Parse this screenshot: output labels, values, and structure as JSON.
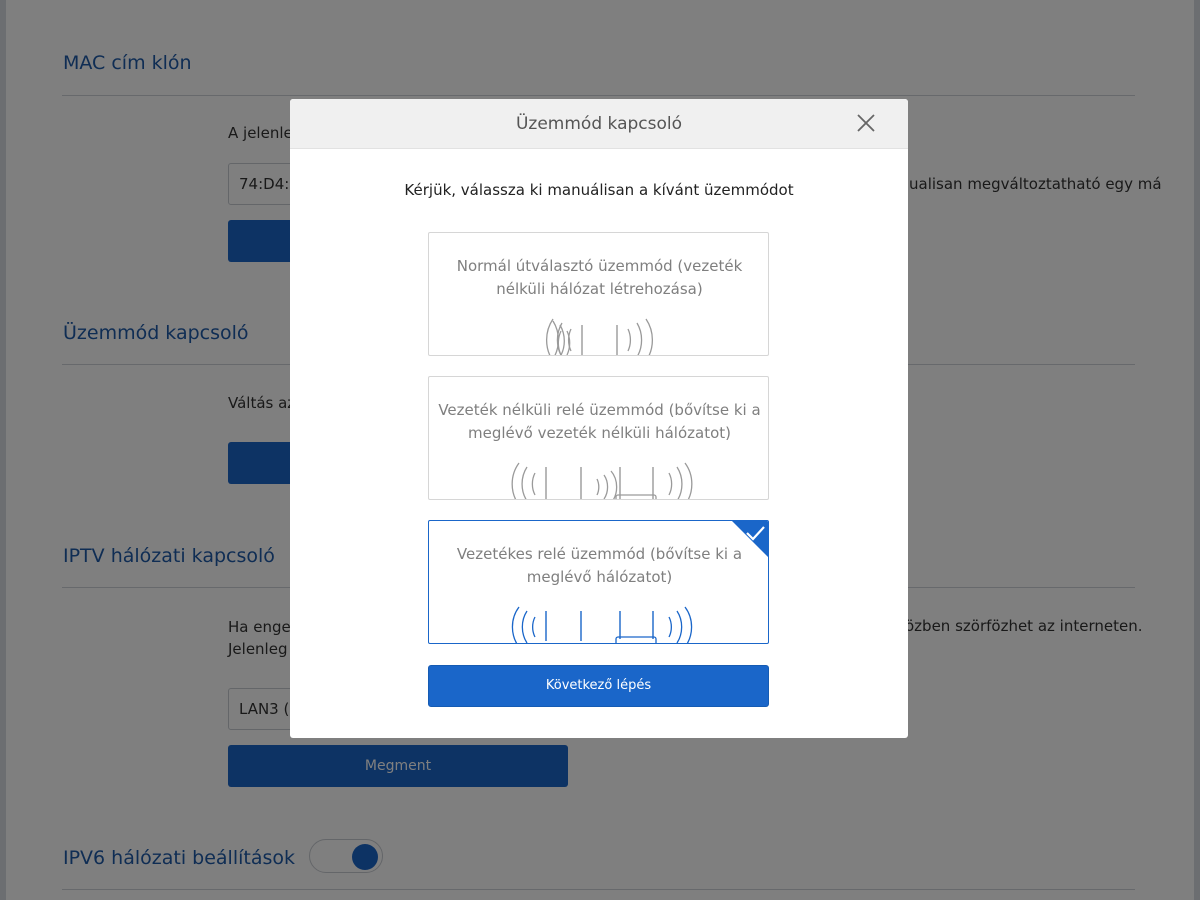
{
  "background": {
    "sections": [
      {
        "title": "MAC cím klón"
      },
      {
        "title": "Üzemmód kapcsoló"
      },
      {
        "title": "IPTV hálózati kapcsoló"
      },
      {
        "title": "IPV6 hálózati beállítások"
      }
    ],
    "mac": {
      "desc_start": "A jelenleg",
      "desc_end": "ualisan megváltoztatható egy má",
      "value": "74:D4:3"
    },
    "mode": {
      "desc_start": "Váltás az"
    },
    "iptv": {
      "desc_line1": "Ha enged",
      "desc_line2": "Jelenleg",
      "desc_end": "özben szörfözhet az interneten.",
      "select_value": "LAN3 (",
      "save_label": "Megment"
    },
    "ipv6": {
      "toggle_on": true
    }
  },
  "modal": {
    "title": "Üzemmód kapcsoló",
    "instruction": "Kérjük, válassza ki manuálisan a kívánt üzemmódot",
    "options": [
      {
        "label": "Normál útválasztó üzemmód (vezeték nélküli hálózat létrehozása)",
        "selected": false
      },
      {
        "label": "Vezeték nélküli relé üzemmód (bővítse ki a meglévő vezeték nélküli hálózatot)",
        "selected": false
      },
      {
        "label": "Vezetékes relé üzemmód (bővítse ki a meglévő hálózatot)",
        "selected": true
      }
    ],
    "next_label": "Következő lépés"
  },
  "colors": {
    "accent": "#1a66c9",
    "section_title": "#1e5aa8",
    "option_text": "#7f7f7f",
    "icon_gray": "#9a9a9a"
  }
}
